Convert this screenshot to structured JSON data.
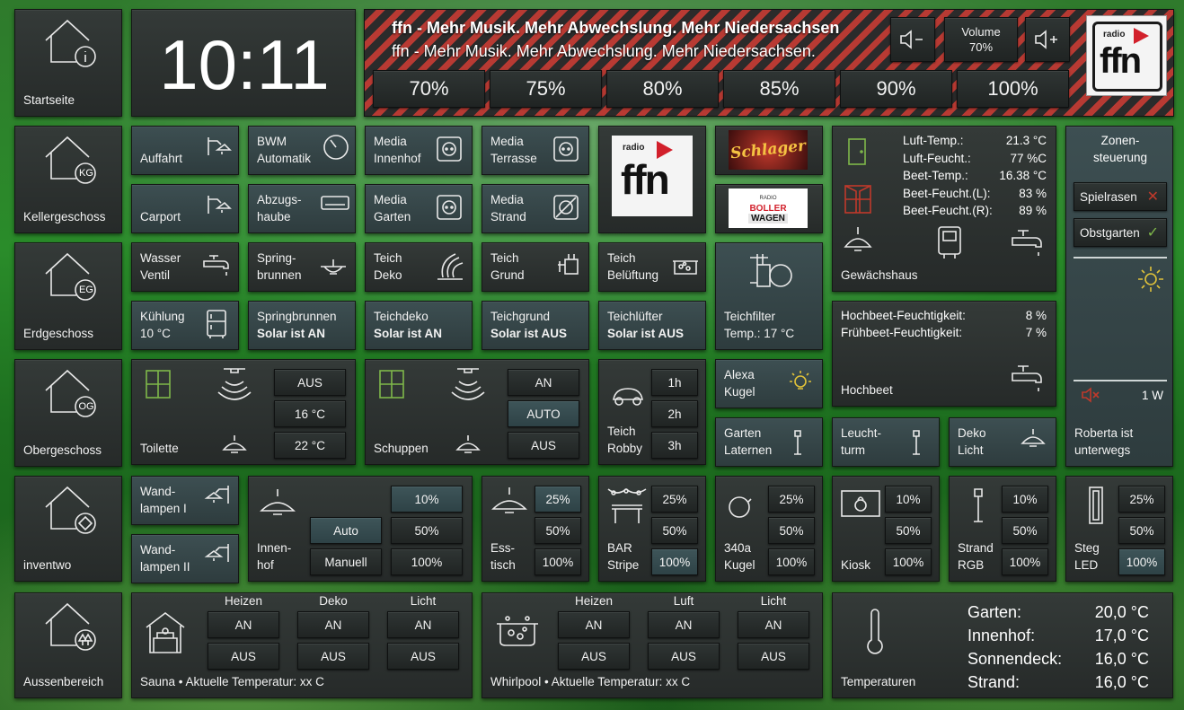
{
  "nav": {
    "startseite": "Startseite",
    "keller": "Kellergeschoss",
    "erd": "Erdgeschoss",
    "ober": "Obergeschoss",
    "inventwo": "inventwo",
    "aussen": "Aussenbereich"
  },
  "badges": {
    "keller": "KG",
    "erd": "EG",
    "ober": "OG"
  },
  "clock": "10:11",
  "radio": {
    "title": "ffn - Mehr Musik. Mehr Abwechslung. Mehr Niedersachsen",
    "subtitle": "ffn - Mehr Musik. Mehr Abwechslung. Mehr Niedersachsen.",
    "volume_label": "Volume",
    "volume_value": "70%",
    "presets": [
      "70%",
      "75%",
      "80%",
      "85%",
      "90%",
      "100%"
    ],
    "logo_small": "radio",
    "logo_big": "ffn"
  },
  "stations": {
    "schlager": "Schlager",
    "boller_small": "RADIO",
    "boller1": "BOLLER",
    "boller2": "WAGEN"
  },
  "keller": {
    "auffahrt": "Auffahrt",
    "bwm": "BWM\nAutomatik",
    "media_innenhof": "Media\nInnenhof",
    "media_terrasse": "Media\nTerrasse",
    "carport": "Carport",
    "abzug": "Abzugs-\nhaube",
    "media_garten": "Media\nGarten",
    "media_strand": "Media\nStrand"
  },
  "erd": {
    "wasser": "Wasser\nVentil",
    "spring": "Spring-\nbrunnen",
    "teich_deko": "Teich\nDeko",
    "teich_grund": "Teich\nGrund",
    "teich_bel": "Teich\nBelüftung",
    "teichfilter": "Teichfilter\nTemp.: 17 °C",
    "kuehlung": "Kühlung\n10 °C",
    "spring_solar": "Springbrunnen",
    "spring_solar_state": "Solar ist AN",
    "teichdeko_solar": "Teichdeko",
    "teichdeko_solar_state": "Solar ist AN",
    "teichgrund_solar": "Teichgrund",
    "teichgrund_solar_state": "Solar ist AUS",
    "teichluefter_solar": "Teichlüfter",
    "teichluefter_solar_state": "Solar ist AUS"
  },
  "greenhouse": {
    "title": "Gewächshaus",
    "rows": [
      {
        "k": "Luft-Temp.:",
        "v": "21.3 °C"
      },
      {
        "k": "Luft-Feucht.:",
        "v": "77 %C"
      },
      {
        "k": "Beet-Temp.:",
        "v": "16.38 °C"
      },
      {
        "k": "Beet-Feucht.(L):",
        "v": "83 %"
      },
      {
        "k": "Beet-Feucht.(R):",
        "v": "89 %"
      }
    ]
  },
  "hochbeet": {
    "title": "Hochbeet",
    "r1k": "Hochbeet-Feuchtigkeit:",
    "r1v": "8 %",
    "r2k": "Frühbeet-Feuchtigkeit:",
    "r2v": "7 %"
  },
  "zonen": {
    "title": "Zonen-\nsteuerung",
    "z1": "Spielrasen",
    "z2": "Obstgarten",
    "power": "1 W",
    "robot": "Roberta ist\nunterwegs"
  },
  "ober": {
    "toilette": "Toilette",
    "toilette_btns": [
      "AUS",
      "16 °C",
      "22 °C"
    ],
    "schuppen": "Schuppen",
    "schuppen_btns": [
      "AN",
      "AUTO",
      "AUS"
    ],
    "robby": "Teich\nRobby",
    "robby_btns": [
      "1h",
      "2h",
      "3h"
    ],
    "alexa": "Alexa\nKugel",
    "garten_lat": "Garten\nLaternen",
    "leucht": "Leucht-\nturm",
    "deko_licht": "Deko\nLicht"
  },
  "inventwo": {
    "wand1": "Wand-\nlampen I",
    "wand2": "Wand-\nlampen II",
    "innenhof": "Innen-\nhof",
    "auto": "Auto",
    "manuell": "Manuell",
    "innenhof_pct": [
      "10%",
      "50%",
      "100%"
    ],
    "esstisch": "Ess-\ntisch",
    "bar": "BAR\nStripe",
    "kugel": "340a\nKugel",
    "kiosk": "Kiosk",
    "strand": "Strand\nRGB",
    "steg": "Steg\nLED",
    "pct_25": [
      "25%",
      "50%",
      "100%"
    ],
    "pct_10": [
      "10%",
      "50%",
      "100%"
    ]
  },
  "aussen": {
    "sauna": "Sauna • Aktuelle Temperatur: xx C",
    "whirl": "Whirlpool • Aktuelle Temperatur: xx C",
    "heizen": "Heizen",
    "deko": "Deko",
    "licht": "Licht",
    "luft": "Luft",
    "an": "AN",
    "aus": "AUS"
  },
  "temps": {
    "title": "Temperaturen",
    "rows": [
      {
        "k": "Garten:",
        "v": "20,0 °C"
      },
      {
        "k": "Innenhof:",
        "v": "17,0 °C"
      },
      {
        "k": "Sonnendeck:",
        "v": "16,0 °C"
      },
      {
        "k": "Strand:",
        "v": "16,0 °C"
      }
    ]
  }
}
